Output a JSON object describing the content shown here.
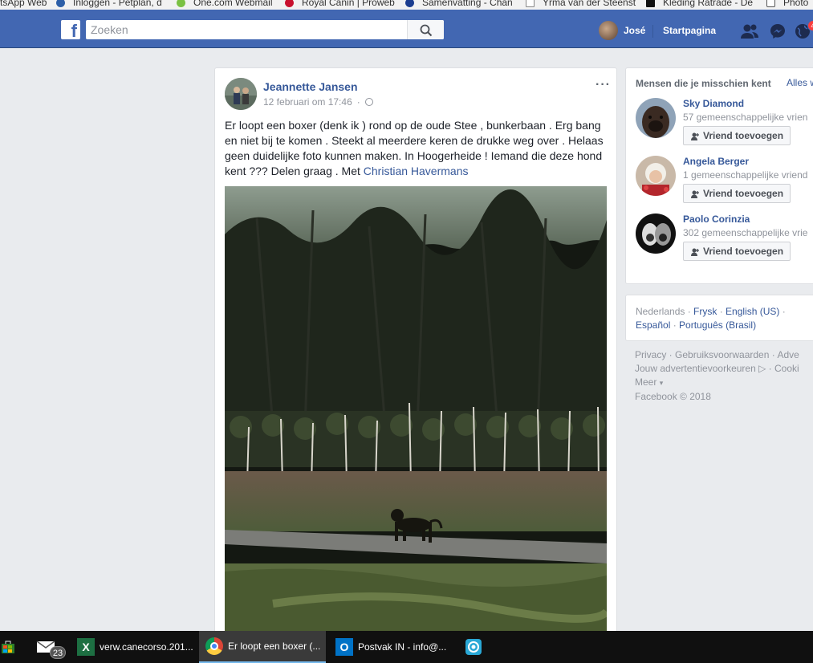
{
  "bookmarks": [
    {
      "label": "tsApp Web",
      "color": "#25d366"
    },
    {
      "label": "Inloggen - Petplan, d",
      "color": "#2d5fa8"
    },
    {
      "label": "One.com Webmail",
      "color": "#7ac143"
    },
    {
      "label": "Royal Canin | Proweb",
      "color": "#c8102e"
    },
    {
      "label": "Samenvatting - Chan",
      "color": "#1a3c8f"
    },
    {
      "label": "Yrma van der Steenst",
      "color": "#888888"
    },
    {
      "label": "Kleding Ratrade - De",
      "color": "#111111"
    },
    {
      "label": "Photo",
      "color": "#555555"
    }
  ],
  "header": {
    "search_placeholder": "Zoeken",
    "user_name": "José",
    "home_label": "Startpagina",
    "notifications_count": "4",
    "brand_color": "#4267b2"
  },
  "post": {
    "author": "Jeannette Jansen",
    "timestamp": "12 februari om 17:46",
    "text": "Er loopt een boxer (denk ik ) rond op de oude Stee , bunkerbaan . Erg bang en niet bij te komen . Steekt al meerdere keren de drukke weg over . Helaas geen duidelijke foto kunnen maken. In Hoogerheide ! Iemand die deze hond kent ??? Delen graag . Met",
    "tagged": "Christian Havermans",
    "more_icon": "ellipsis-icon"
  },
  "pymk": {
    "title": "Mensen die je misschien kent",
    "see_all": "Alles w",
    "add_label": "Vriend toevoegen",
    "people": [
      {
        "name": "Sky Diamond",
        "mutual": "57 gemeenschappelijke vrien"
      },
      {
        "name": "Angela Berger",
        "mutual": "1 gemeenschappelijke vriend"
      },
      {
        "name": "Paolo Corinzia",
        "mutual": "302 gemeenschappelijke vrie"
      }
    ]
  },
  "languages": {
    "current": "Nederlands",
    "options": [
      "Frysk",
      "English (US)",
      "Español",
      "Português (Brasil)"
    ]
  },
  "footer": {
    "links": [
      "Privacy",
      "Gebruiksvoorwaarden",
      "Adve"
    ],
    "links2": [
      "Jouw advertentievoorkeuren",
      "Cooki"
    ],
    "more": "Meer",
    "copyright": "Facebook © 2018"
  },
  "taskbar": {
    "mail_badge": "23",
    "items": [
      {
        "label": "verw.canecorso.201..."
      },
      {
        "label": "Er loopt een boxer (..."
      },
      {
        "label": "Postvak IN - info@..."
      }
    ]
  }
}
